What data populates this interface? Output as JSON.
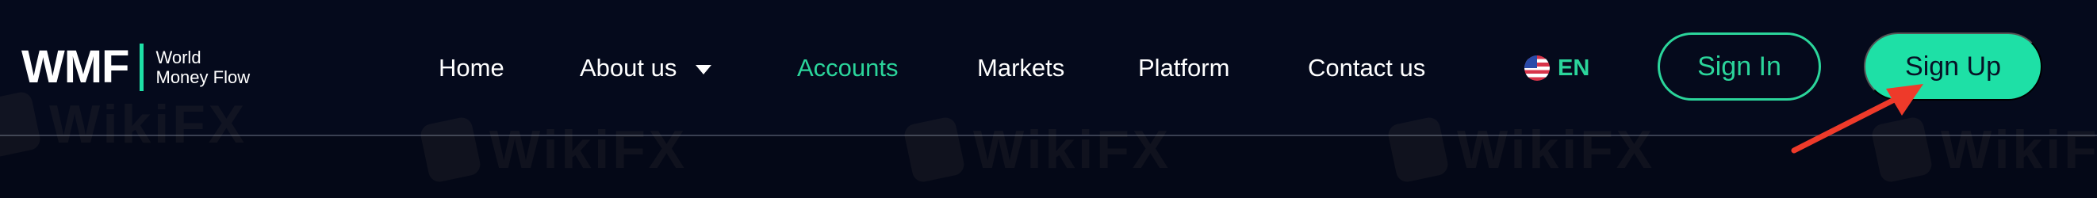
{
  "logo": {
    "mark": "WMF",
    "line1": "World",
    "line2": "Money Flow"
  },
  "nav": {
    "home": "Home",
    "about": "About us",
    "accounts": "Accounts",
    "markets": "Markets",
    "platform": "Platform",
    "contact": "Contact us"
  },
  "language": {
    "code": "EN",
    "flag_icon": "us-flag-icon"
  },
  "buttons": {
    "sign_in": "Sign In",
    "sign_up": "Sign Up"
  },
  "watermark": {
    "text": "WikiFX"
  },
  "colors": {
    "background": "#050a1c",
    "accent": "#1ee0a6",
    "active_link": "#2bd59b",
    "arrow": "#ee3a2a"
  }
}
